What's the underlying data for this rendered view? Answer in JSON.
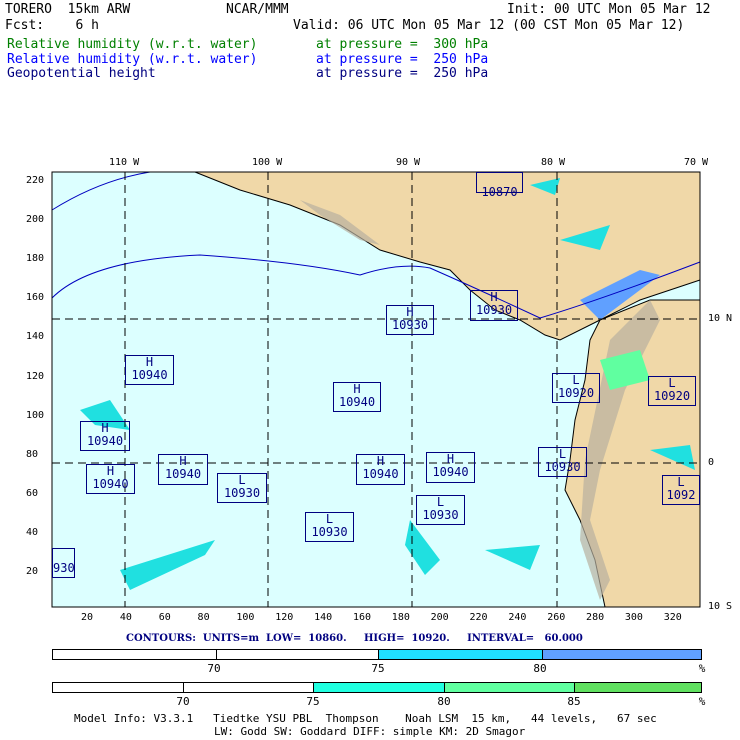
{
  "header": {
    "model": "TORERO  15km ARW",
    "org": "NCAR/MMM",
    "init": "Init: 00 UTC Mon 05 Mar 12",
    "fcst": "Fcst:    6 h",
    "valid": "Valid: 06 UTC Mon 05 Mar 12 (00 CST Mon 05 Mar 12)"
  },
  "fields": [
    {
      "name": "Relative humidity (w.r.t. water)",
      "level": "at pressure =  300 hPa",
      "color": "#008000"
    },
    {
      "name": "Relative humidity (w.r.t. water)",
      "level": "at pressure =  250 hPa",
      "color": "#0000ff"
    },
    {
      "name": "Geopotential height",
      "level": "at pressure =  250 hPa",
      "color": "#000080"
    }
  ],
  "map": {
    "top_labels": [
      "110 W",
      "100 W",
      "90 W",
      "80 W",
      "70 W"
    ],
    "right_labels": [
      "10 N",
      "0",
      "10 S"
    ],
    "bottom_ticks": [
      "20",
      "40",
      "60",
      "80",
      "100",
      "120",
      "140",
      "160",
      "180",
      "200",
      "220",
      "240",
      "260",
      "280",
      "300",
      "320"
    ],
    "left_ticks": [
      "220",
      "200",
      "180",
      "160",
      "140",
      "120",
      "100",
      "80",
      "60",
      "40",
      "20"
    ],
    "centers": [
      {
        "type": "",
        "value": "10870"
      },
      {
        "type": "H",
        "value": "10930"
      },
      {
        "type": "H",
        "value": "10930"
      },
      {
        "type": "H",
        "value": "10940"
      },
      {
        "type": "H",
        "value": "10940"
      },
      {
        "type": "L",
        "value": "10920"
      },
      {
        "type": "L",
        "value": "10920"
      },
      {
        "type": "H",
        "value": "10940"
      },
      {
        "type": "H",
        "value": "10940"
      },
      {
        "type": "H",
        "value": "10940"
      },
      {
        "type": "L",
        "value": "10930"
      },
      {
        "type": "H",
        "value": "10940"
      },
      {
        "type": "H",
        "value": "10940"
      },
      {
        "type": "L",
        "value": "10930"
      },
      {
        "type": "L",
        "value": "10930"
      },
      {
        "type": "L",
        "value": "10930"
      },
      {
        "type": "L",
        "value": "1092"
      },
      {
        "type": "",
        "value": "930"
      }
    ]
  },
  "contours": "CONTOURS:  UNITS=m  LOW=  10860.     HIGH=  10920.     INTERVAL=   60.000",
  "colorbar1": {
    "labels": [
      "70",
      "75",
      "80",
      "%"
    ],
    "colors": [
      "#ffffff",
      "#ffffff",
      "#20e0ff",
      "#60a0ff"
    ]
  },
  "colorbar2": {
    "labels": [
      "70",
      "75",
      "80",
      "85",
      "%"
    ],
    "colors": [
      "#ffffff",
      "#ffffff",
      "#20ffe0",
      "#60ffa0",
      "#60e060"
    ]
  },
  "footer": {
    "line1": "Model Info: V3.3.1   Tiedtke YSU PBL  Thompson    Noah LSM  15 km,   44 levels,   67 sec",
    "line2": "LW: Godd SW: Goddard DIFF: simple KM: 2D Smagor"
  }
}
